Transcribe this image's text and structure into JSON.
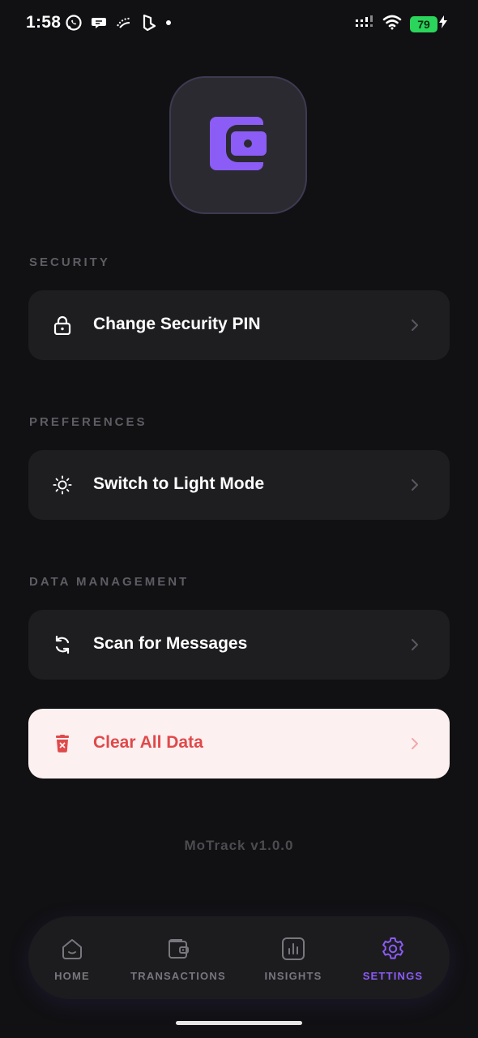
{
  "status_bar": {
    "time": "1:58",
    "battery": "79"
  },
  "sections": {
    "security": "SECURITY",
    "preferences": "PREFERENCES",
    "data_management": "DATA MANAGEMENT"
  },
  "rows": {
    "change_pin": "Change Security PIN",
    "light_mode": "Switch to Light Mode",
    "scan_messages": "Scan for Messages",
    "clear_data": "Clear All Data"
  },
  "version": "MoTrack v1.0.0",
  "nav": {
    "home": "HOME",
    "transactions": "TRANSACTIONS",
    "insights": "INSIGHTS",
    "settings": "SETTINGS",
    "active": "settings"
  },
  "colors": {
    "accent": "#8b5cf6",
    "danger": "#e0494a",
    "danger_bg": "#fdf0f0",
    "background": "#111113",
    "row_bg": "#1e1e21"
  },
  "icons": {
    "logo": "wallet-icon",
    "change_pin": "lock-icon",
    "light_mode": "sun-icon",
    "scan_messages": "refresh-icon",
    "clear_data": "trash-icon",
    "home": "home-icon",
    "transactions": "wallet-icon",
    "insights": "chart-icon",
    "settings": "gear-icon"
  }
}
